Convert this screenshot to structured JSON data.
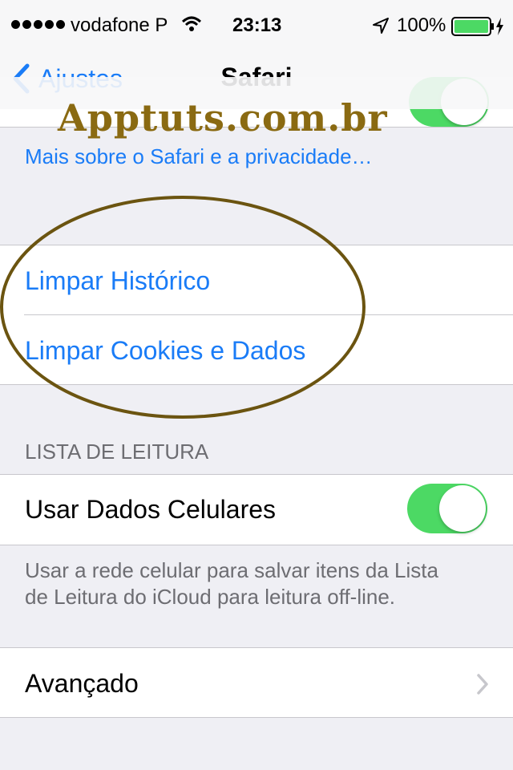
{
  "status_bar": {
    "carrier": "vodafone P",
    "time": "23:13",
    "battery": "100%"
  },
  "nav": {
    "back_label": "Ajustes",
    "title": "Safari"
  },
  "watermark": "Apptuts.com.br",
  "privacy_link": "Mais sobre o Safari e a privacidade…",
  "clear_section": {
    "clear_history": "Limpar Histórico",
    "clear_cookies": "Limpar Cookies e Dados"
  },
  "reading_list": {
    "header": "LISTA DE LEITURA",
    "use_cellular_label": "Usar Dados Celulares",
    "use_cellular_on": true,
    "footnote_line1": "Usar a rede celular para salvar itens da Lista",
    "footnote_line2": "de Leitura do iCloud para leitura off-line."
  },
  "advanced": {
    "label": "Avançado"
  },
  "colors": {
    "accent": "#1a7cf7",
    "toggle_on": "#4cd964",
    "battery": "#4cd964",
    "watermark": "#8a6a12",
    "annotation_oval": "#6b5410"
  }
}
